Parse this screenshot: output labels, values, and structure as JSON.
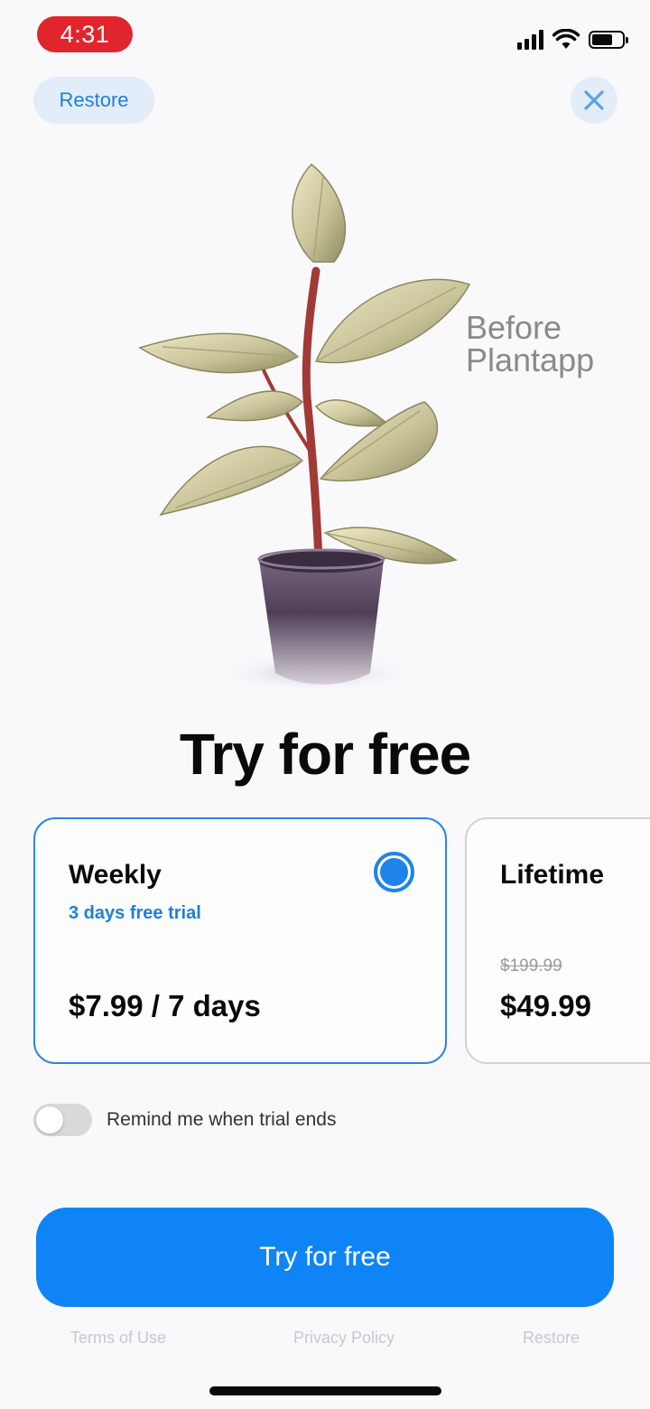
{
  "status_bar": {
    "time": "4:31",
    "icons": [
      "cellular-signal-icon",
      "wifi-icon",
      "battery-icon"
    ]
  },
  "header": {
    "restore_label": "Restore",
    "close_icon": "close-icon"
  },
  "hero": {
    "image": "rubber-plant-in-pot-illustration",
    "caption_line1": "Before",
    "caption_line2": "Plantapp"
  },
  "headline": "Try for free",
  "plans": [
    {
      "name": "Weekly",
      "trial": "3 days free trial",
      "price": "$7.99 / 7 days",
      "selected": true
    },
    {
      "name": "Lifetime",
      "original_price": "$199.99",
      "price": "$49.99",
      "selected": false
    }
  ],
  "reminder": {
    "label": "Remind me when trial ends",
    "enabled": false
  },
  "cta_label": "Try for free",
  "footer": {
    "terms": "Terms of Use",
    "privacy": "Privacy Policy",
    "restore": "Restore"
  },
  "colors": {
    "accent": "#0e84f6",
    "selected_border": "#2b86dc",
    "status_pill": "#e0262c",
    "background": "#f9f8fb"
  }
}
